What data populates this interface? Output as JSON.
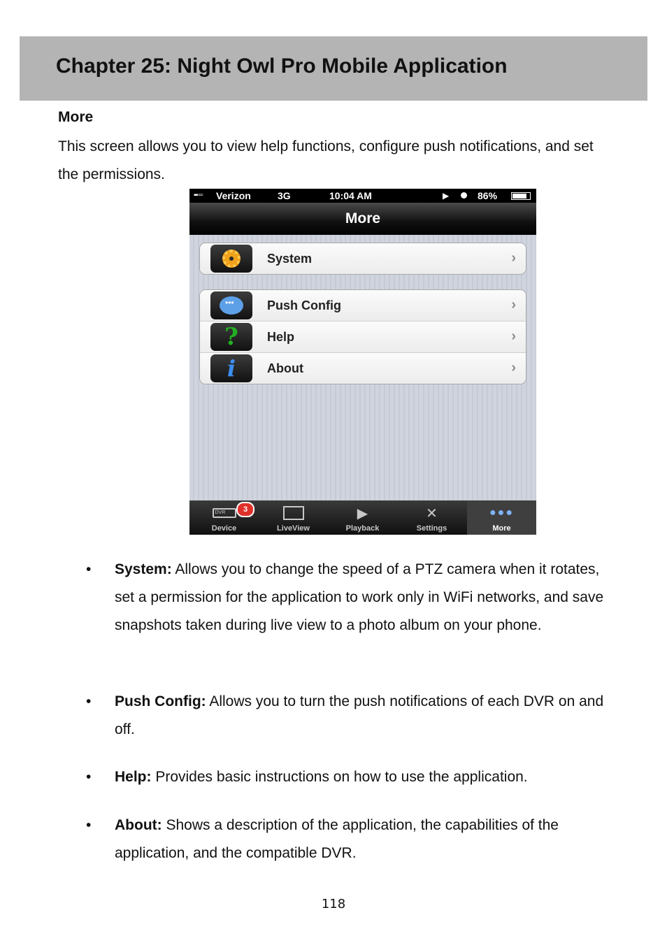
{
  "chapter_title": "Chapter 25: Night Owl Pro Mobile Application",
  "section": {
    "heading": "More",
    "intro": "This screen allows you to view help functions, configure push notifications, and set the permissions."
  },
  "phone": {
    "status_bar": {
      "signal": "▪▪▫▫▫",
      "carrier": "Verizon",
      "network": "3G",
      "time": "10:04 AM",
      "battery": "86%"
    },
    "nav_title": "More",
    "groups": [
      {
        "rows": [
          {
            "label": "System",
            "icon": "gear-icon"
          }
        ]
      },
      {
        "rows": [
          {
            "label": "Push Config",
            "icon": "chat-bubble-icon"
          },
          {
            "label": "Help",
            "icon": "question-mark-icon"
          },
          {
            "label": "About",
            "icon": "info-icon"
          }
        ]
      }
    ],
    "tab_bar": [
      {
        "label": "Device",
        "icon": "dvr-icon",
        "icon_text": "DVR",
        "badge": "3",
        "active": false
      },
      {
        "label": "LiveView",
        "icon": "monitor-icon",
        "active": false
      },
      {
        "label": "Playback",
        "icon": "playback-icon",
        "active": false
      },
      {
        "label": "Settings",
        "icon": "tools-icon",
        "active": false
      },
      {
        "label": "More",
        "icon": "more-dots-icon",
        "active": true
      }
    ]
  },
  "bullets": [
    {
      "term": "System:",
      "text": " Allows you to change the speed of a PTZ camera when it rotates, set a permission for the application to work only in WiFi networks, and save snapshots taken during live view to a photo album on your phone."
    },
    {
      "term": "Push Config:",
      "text": " Allows you to turn the push notifications of each DVR on and off."
    },
    {
      "term": "Help:",
      "text": " Provides basic instructions on how to use the application."
    },
    {
      "term": "About:",
      "text": " Shows a description of the application, the capabilities of the application, and the compatible DVR."
    }
  ],
  "bullet_symbol": "•",
  "chevron": "›",
  "page_number": "118"
}
